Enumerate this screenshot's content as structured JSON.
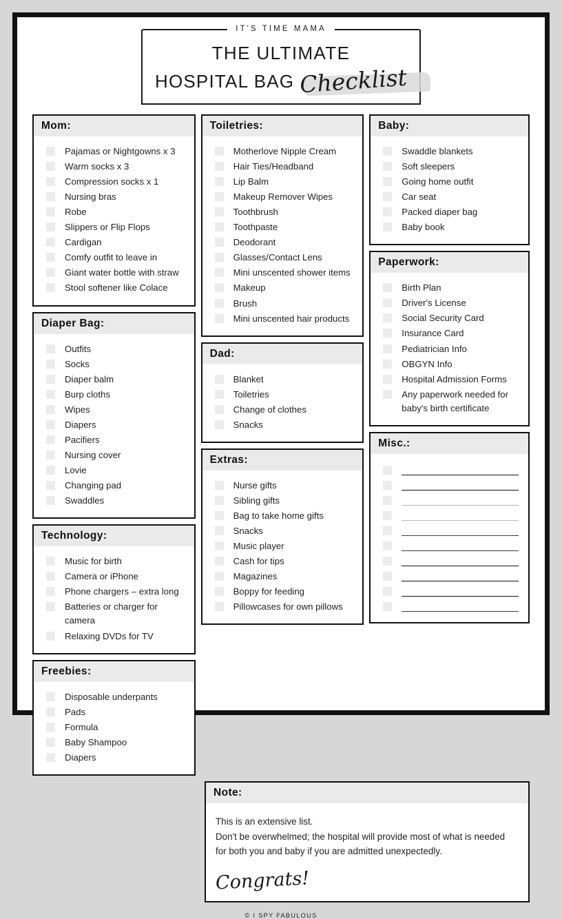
{
  "header": {
    "eyebrow": "IT'S TIME MAMA",
    "title_line1": "THE ULTIMATE",
    "title_line2": "HOSPITAL BAG",
    "title_script": "Checklist"
  },
  "columns": [
    {
      "sections": [
        {
          "id": "mom",
          "title": "Mom:",
          "items": [
            "Pajamas or Nightgowns x 3",
            "Warm socks x 3",
            "Compression socks x 1",
            "Nursing bras",
            "Robe",
            "Slippers or Flip Flops",
            "Cardigan",
            "Comfy outfit to leave in",
            "Giant water bottle with straw",
            "Stool softener like Colace"
          ]
        },
        {
          "id": "diaper-bag",
          "title": "Diaper Bag:",
          "items": [
            "Outfits",
            "Socks",
            "Diaper balm",
            "Burp cloths",
            "Wipes",
            "Diapers",
            "Pacifiers",
            "Nursing cover",
            "Lovie",
            "Changing pad",
            "Swaddles"
          ]
        },
        {
          "id": "technology",
          "title": "Technology:",
          "items": [
            "Music for birth",
            "Camera or iPhone",
            "Phone chargers – extra long",
            "Batteries or charger for camera",
            "Relaxing DVDs for TV"
          ]
        },
        {
          "id": "freebies",
          "title": "Freebies:",
          "items": [
            "Disposable underpants",
            "Pads",
            "Formula",
            "Baby Shampoo",
            "Diapers"
          ]
        }
      ]
    },
    {
      "sections": [
        {
          "id": "toiletries",
          "title": "Toiletries:",
          "items": [
            "Motherlove Nipple Cream",
            "Hair Ties/Headband",
            "Lip Balm",
            "Makeup Remover Wipes",
            "Toothbrush",
            "Toothpaste",
            "Deodorant",
            "Glasses/Contact Lens",
            "Mini unscented shower items",
            "Makeup",
            "Brush",
            "Mini unscented hair products"
          ]
        },
        {
          "id": "dad",
          "title": "Dad:",
          "items": [
            "Blanket",
            "Toiletries",
            "Change of clothes",
            "Snacks"
          ]
        },
        {
          "id": "extras",
          "title": "Extras:",
          "items": [
            "Nurse gifts",
            "Sibling gifts",
            "Bag to take home gifts",
            "Snacks",
            "Music player",
            "Cash for tips",
            "Magazines",
            "Boppy for feeding",
            "Pillowcases for own pillows"
          ]
        }
      ]
    },
    {
      "sections": [
        {
          "id": "baby",
          "title": "Baby:",
          "items": [
            "Swaddle blankets",
            "Soft sleepers",
            "Going home outfit",
            "Car seat",
            "Packed diaper bag",
            "Baby book"
          ]
        },
        {
          "id": "paperwork",
          "title": "Paperwork:",
          "items": [
            "Birth Plan",
            "Driver's License",
            "Social Security Card",
            "Insurance Card",
            "Pediatrician Info",
            "OBGYN Info",
            "Hospital Admission Forms",
            "Any paperwork needed for baby's birth certificate"
          ]
        },
        {
          "id": "misc",
          "title": "Misc.:",
          "blank_lines": 10,
          "items": []
        }
      ]
    }
  ],
  "note": {
    "title": "Note:",
    "lines": [
      "This is an extensive list.",
      "Don't be overwhelmed; the hospital will provide most of what is needed",
      "for both you and baby if you are admitted unexpectedly."
    ],
    "signature": "Congrats!"
  },
  "footer": {
    "text": "© I SPY FABULOUS"
  }
}
